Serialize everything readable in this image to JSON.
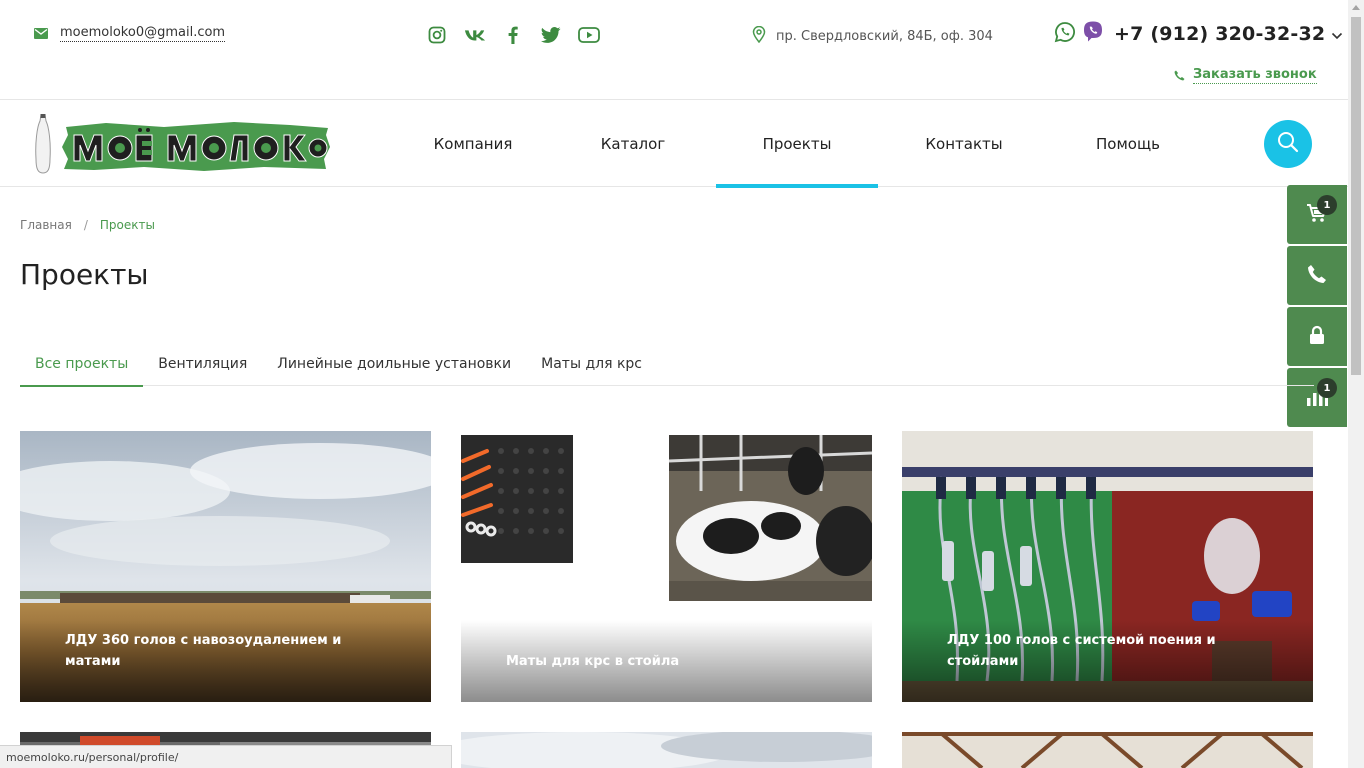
{
  "contacts": {
    "email": "moemoloko0@gmail.com",
    "address": "пр. Свердловский, 84Б, оф. 304",
    "phone": "+7 (912) 320-32-32",
    "callback_label": "Заказать звонок"
  },
  "socials": [
    "instagram-icon",
    "vk-icon",
    "facebook-icon",
    "twitter-icon",
    "youtube-icon"
  ],
  "logo": {
    "text": "МОЁ МОЛОКО"
  },
  "nav": {
    "items": [
      {
        "label": "Компания"
      },
      {
        "label": "Каталог"
      },
      {
        "label": "Проекты"
      },
      {
        "label": "Контакты"
      },
      {
        "label": "Помощь"
      }
    ],
    "active": "Проекты"
  },
  "widgets": {
    "cart_count": "1",
    "compare_count": "1"
  },
  "breadcrumb": {
    "home": "Главная",
    "separator": "/",
    "current": "Проекты"
  },
  "page": {
    "title": "Проекты"
  },
  "tabs": [
    {
      "label": "Все проекты"
    },
    {
      "label": "Вентиляция"
    },
    {
      "label": "Линейные доильные установки"
    },
    {
      "label": "Маты для крс"
    }
  ],
  "cards": [
    {
      "title": "ЛДУ 360 голов с навозоудалением и матами"
    },
    {
      "title": "Маты для крс в стойла"
    },
    {
      "title": "ЛДУ 100 голов с системой поения и стойлами"
    }
  ],
  "status": {
    "url": "moemoloko.ru/personal/profile/"
  },
  "colors": {
    "accent": "#1ac2e6",
    "green": "#4a9a4e",
    "widget": "#4f8a4f"
  }
}
